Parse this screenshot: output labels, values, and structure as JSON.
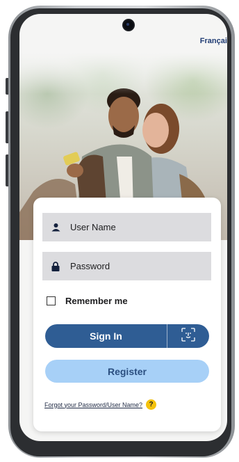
{
  "header": {
    "language_link": "Français"
  },
  "login": {
    "username_placeholder": "User Name",
    "password_placeholder": "Password",
    "remember_label": "Remember me",
    "remember_checked": false,
    "signin_label": "Sign In",
    "register_label": "Register",
    "forgot_link": "Forgot your Password/User Name?",
    "help_glyph": "?"
  },
  "colors": {
    "primary": "#2f5d94",
    "register_bg": "#a7d0f7",
    "help_badge": "#f4c20d",
    "language_link": "#1f3b73"
  },
  "icons": [
    "user-icon",
    "lock-icon",
    "face-id-icon",
    "help-icon"
  ]
}
